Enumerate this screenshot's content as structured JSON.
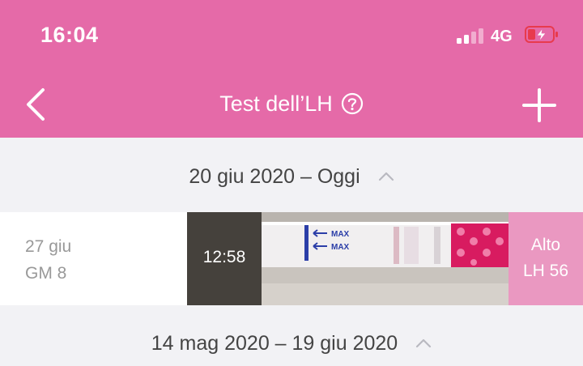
{
  "status_bar": {
    "time": "16:04",
    "network": "4G"
  },
  "header": {
    "title": "Test dell’LH"
  },
  "sections": [
    {
      "label": "20 giu 2020 – Oggi"
    },
    {
      "label": "14 mag 2020 – 19 giu 2020"
    }
  ],
  "entry": {
    "date": "27 giu",
    "cycle_day": "GM 8",
    "time": "12:58",
    "result_level": "Alto",
    "result_value": "LH 56",
    "strip_text": "MAX"
  },
  "colors": {
    "accent": "#e56aa8",
    "result_bg": "#ea98c1",
    "background": "#f2f2f5"
  }
}
